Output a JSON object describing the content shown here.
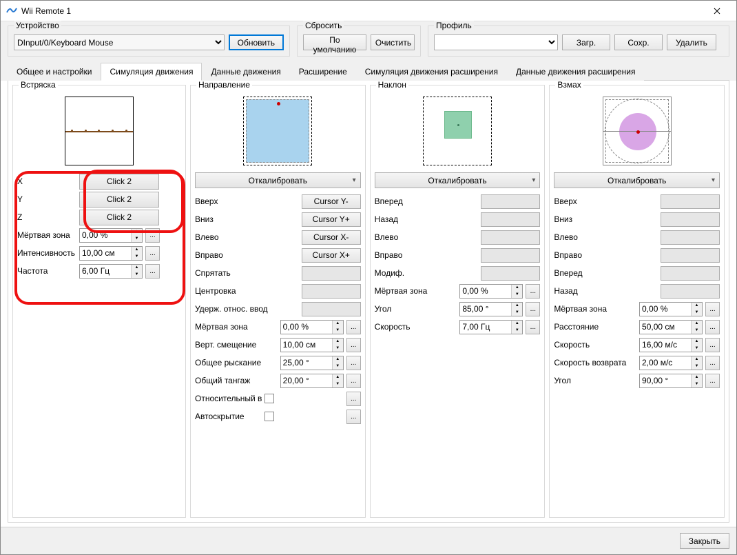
{
  "window": {
    "title": "Wii Remote 1"
  },
  "device": {
    "group_label": "Устройство",
    "selected": "DInput/0/Keyboard Mouse",
    "refresh": "Обновить"
  },
  "reset": {
    "group_label": "Сбросить",
    "default": "По умолчанию",
    "clear": "Очистить"
  },
  "profile": {
    "group_label": "Профиль",
    "load": "Загр.",
    "save": "Сохр.",
    "delete": "Удалить"
  },
  "tabs": {
    "general": "Общее и настройки",
    "motion_sim": "Симуляция движения",
    "motion_data": "Данные движения",
    "extension": "Расширение",
    "ext_motion_sim": "Симуляция движения расширения",
    "ext_motion_data": "Данные движения расширения"
  },
  "recalibrate": "Откалибровать",
  "shake": {
    "title": "Встряска",
    "rows": {
      "x": {
        "label": "X",
        "value": "Click 2"
      },
      "y": {
        "label": "Y",
        "value": "Click 2"
      },
      "z": {
        "label": "Z",
        "value": "Click 2"
      },
      "deadzone": {
        "label": "Мёртвая зона",
        "value": "0,00 %"
      },
      "intensity": {
        "label": "Интенсивность",
        "value": "10,00 см"
      },
      "frequency": {
        "label": "Частота",
        "value": "6,00 Гц"
      }
    }
  },
  "direction": {
    "title": "Направление",
    "rows": {
      "up": {
        "label": "Вверх",
        "value": "Cursor Y-"
      },
      "down": {
        "label": "Вниз",
        "value": "Cursor Y+"
      },
      "left": {
        "label": "Влево",
        "value": "Cursor X-"
      },
      "right": {
        "label": "Вправо",
        "value": "Cursor X+"
      },
      "hide": {
        "label": "Спрятать"
      },
      "center": {
        "label": "Центровка"
      },
      "holdrel": {
        "label": "Удерж. относ. ввод"
      },
      "deadzone": {
        "label": "Мёртвая зона",
        "value": "0,00 %"
      },
      "vshift": {
        "label": "Верт. смещение",
        "value": "10,00 см"
      },
      "yaw": {
        "label": "Общее рыскание",
        "value": "25,00 °"
      },
      "pitch": {
        "label": "Общий тангаж",
        "value": "20,00 °"
      },
      "relinput": {
        "label": "Относительный ввод"
      },
      "autohide": {
        "label": "Автоскрытие"
      }
    }
  },
  "tilt": {
    "title": "Наклон",
    "rows": {
      "fwd": {
        "label": "Вперед"
      },
      "back": {
        "label": "Назад"
      },
      "left": {
        "label": "Влево"
      },
      "right": {
        "label": "Вправо"
      },
      "mod": {
        "label": "Модиф."
      },
      "deadzone": {
        "label": "Мёртвая зона",
        "value": "0,00 %"
      },
      "angle": {
        "label": "Угол",
        "value": "85,00 °"
      },
      "speed": {
        "label": "Скорость",
        "value": "7,00 Гц"
      }
    }
  },
  "swing": {
    "title": "Взмах",
    "rows": {
      "up": {
        "label": "Вверх"
      },
      "down": {
        "label": "Вниз"
      },
      "left": {
        "label": "Влево"
      },
      "right": {
        "label": "Вправо"
      },
      "fwd": {
        "label": "Вперед"
      },
      "back": {
        "label": "Назад"
      },
      "deadzone": {
        "label": "Мёртвая зона",
        "value": "0,00 %"
      },
      "distance": {
        "label": "Расстояние",
        "value": "50,00 см"
      },
      "speed": {
        "label": "Скорость",
        "value": "16,00 м/с"
      },
      "retspeed": {
        "label": "Скорость возврата",
        "value": "2,00 м/с"
      },
      "angle": {
        "label": "Угол",
        "value": "90,00 °"
      }
    }
  },
  "footer": {
    "close": "Закрыть"
  }
}
